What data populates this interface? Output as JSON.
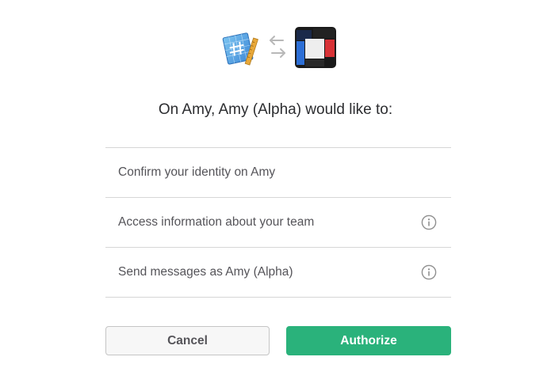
{
  "logos": {
    "app_icon": "hashtag-app-icon",
    "swap_icon": "swap-arrows-icon",
    "team_icon": "team-logo-icon"
  },
  "heading": "On Amy, Amy (Alpha) would like to:",
  "permissions": [
    {
      "label": "Confirm your identity on Amy",
      "has_info": false
    },
    {
      "label": "Access information about your team",
      "has_info": true,
      "icon": "info-icon"
    },
    {
      "label": "Send messages as Amy (Alpha)",
      "has_info": true,
      "icon": "info-icon"
    }
  ],
  "buttons": {
    "cancel_label": "Cancel",
    "authorize_label": "Authorize"
  },
  "colors": {
    "authorize_bg": "#2ab27b",
    "cancel_bg": "#f7f7f7",
    "divider": "#d6d6d6",
    "heading_text": "#2c2d30",
    "body_text": "#555459"
  }
}
